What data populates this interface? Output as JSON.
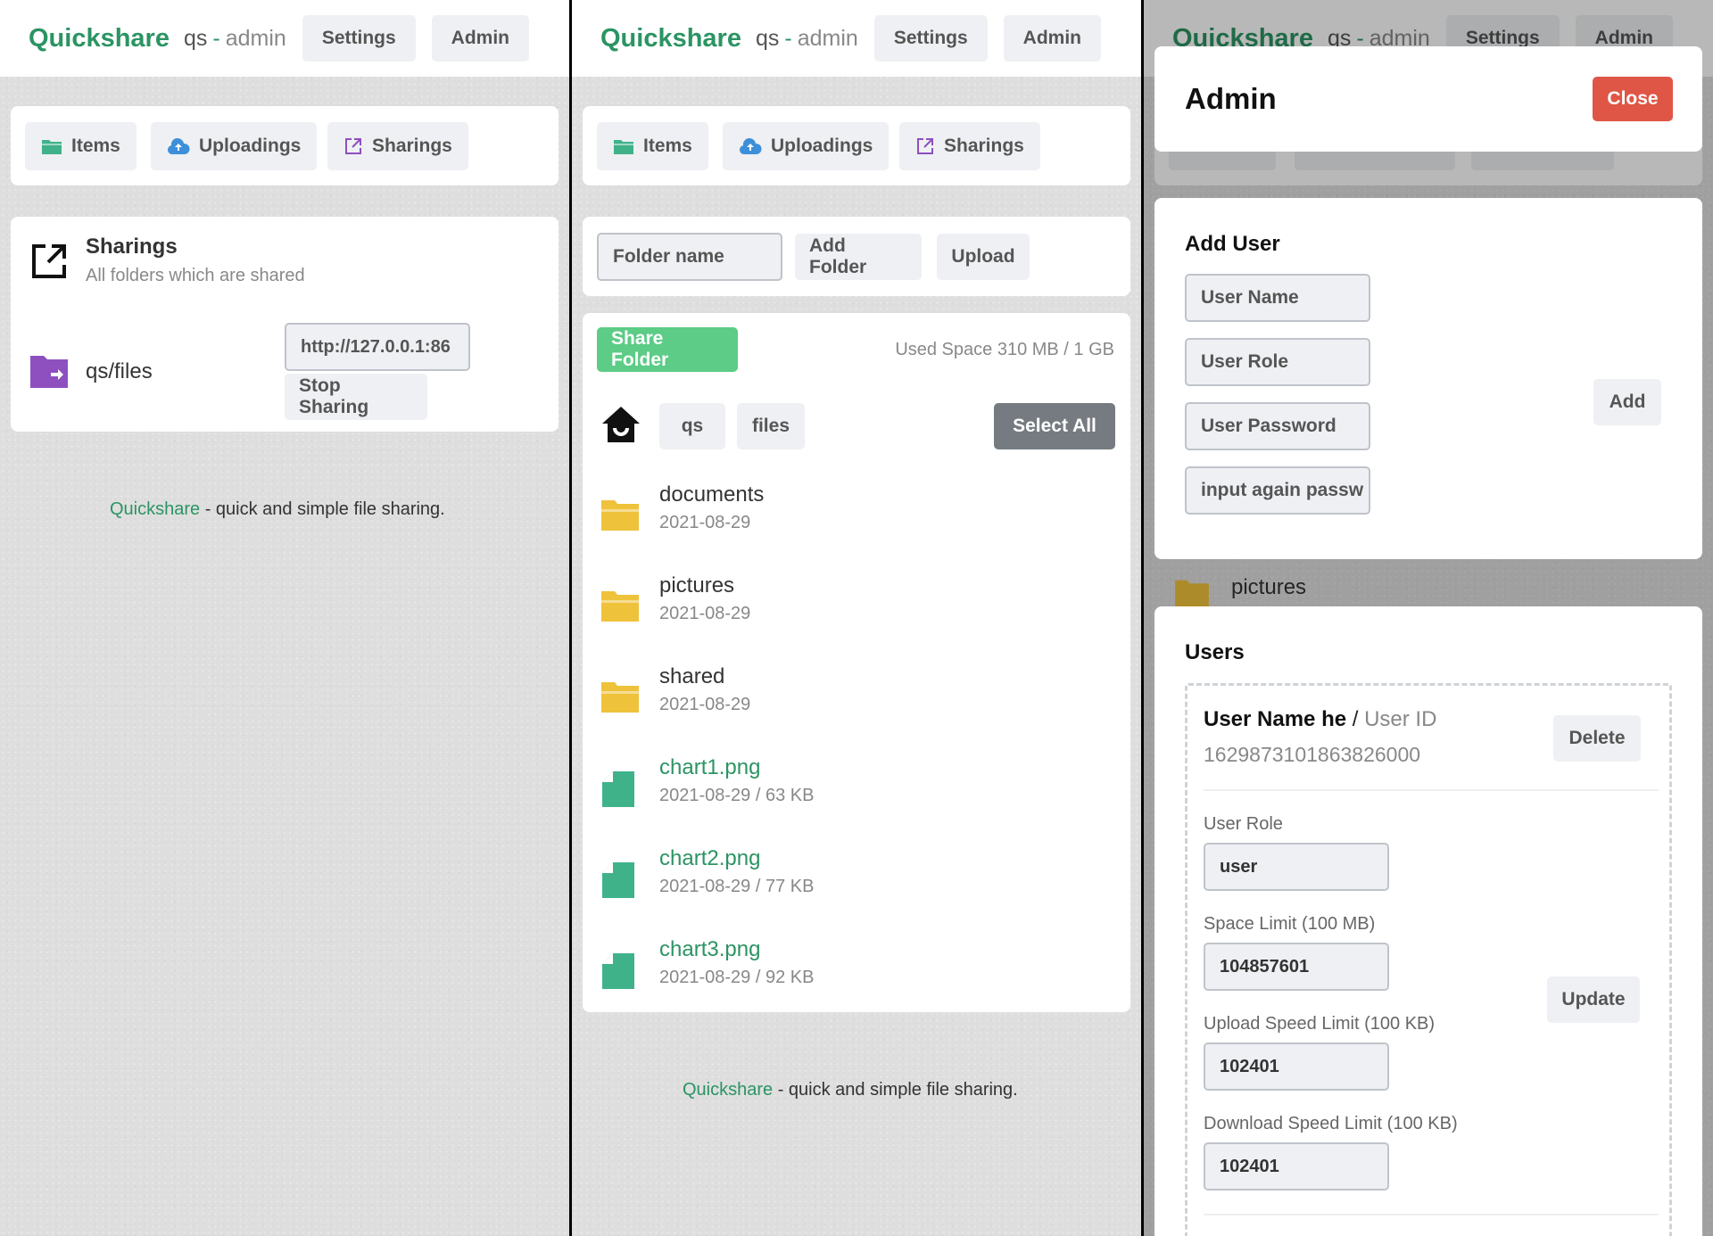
{
  "header": {
    "brand": "Quickshare",
    "user": "qs",
    "dash": "-",
    "role": "admin",
    "settings_label": "Settings",
    "admin_label": "Admin"
  },
  "tabs": {
    "items": "Items",
    "uploadings": "Uploadings",
    "sharings": "Sharings"
  },
  "sharings_panel": {
    "title": "Sharings",
    "subtitle": "All folders which are shared",
    "folder": "qs/files",
    "link": "http://127.0.0.1:86",
    "stop_label": "Stop Sharing"
  },
  "footer": {
    "brand": "Quickshare",
    "text": " - quick and simple file sharing."
  },
  "items_panel": {
    "folder_placeholder": "Folder name",
    "add_folder_label": "Add Folder",
    "upload_label": "Upload",
    "share_folder_label": "Share Folder",
    "used_space": "Used Space 310 MB / 1 GB",
    "breadcrumb": [
      "qs",
      "files"
    ],
    "select_all_label": "Select All",
    "entries": [
      {
        "name": "documents",
        "meta": "2021-08-29",
        "type": "folder"
      },
      {
        "name": "pictures",
        "meta": "2021-08-29",
        "type": "folder"
      },
      {
        "name": "shared",
        "meta": "2021-08-29",
        "type": "folder"
      },
      {
        "name": "chart1.png",
        "meta": "2021-08-29 / 63 KB",
        "type": "file"
      },
      {
        "name": "chart2.png",
        "meta": "2021-08-29 / 77 KB",
        "type": "file"
      },
      {
        "name": "chart3.png",
        "meta": "2021-08-29 / 92 KB",
        "type": "file"
      }
    ]
  },
  "admin_modal": {
    "title": "Admin",
    "close_label": "Close",
    "background_folder": "pictures",
    "add_user": {
      "title": "Add User",
      "name_placeholder": "User Name",
      "role_placeholder": "User Role",
      "password_placeholder": "User Password",
      "password_again_placeholder": "input again passw",
      "add_label": "Add"
    },
    "users": {
      "title": "Users",
      "user_name": "User Name he",
      "separator": "/",
      "user_id_label": "User ID",
      "user_id": "1629873101863826000",
      "delete_label": "Delete",
      "role_label": "User Role",
      "role_value": "user",
      "space_label": "Space Limit (100 MB)",
      "space_value": "104857601",
      "upload_label": "Upload Speed Limit (100 KB)",
      "upload_value": "102401",
      "download_label": "Download Speed Limit (100 KB)",
      "download_value": "102401",
      "update_label": "Update"
    }
  },
  "colors": {
    "brand_green": "#2b9463",
    "share_green": "#5ccc86",
    "close_red": "#e05646",
    "folder_yellow": "#efc23b",
    "file_green": "#3fb28a",
    "sharing_purple": "#8e4fbf",
    "upload_blue": "#3d8fd9"
  }
}
